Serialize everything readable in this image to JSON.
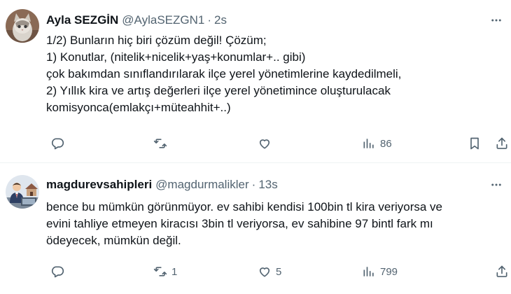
{
  "tweets": [
    {
      "author": {
        "name": "Ayla SEZGİN",
        "handle": "@AylaSEZGN1",
        "time": "2s"
      },
      "lines": [
        "1/2) Bunların hiç biri çözüm değil! Çözüm;",
        "1) Konutlar, (nitelik+nicelik+yaş+konumlar+.. gibi)",
        "çok bakımdan sınıflandırılarak ilçe yerel yönetimlerine kaydedilmeli,",
        "2) Yıllık kira ve artış değerleri ilçe yerel yönetimince oluşturulacak",
        "komisyonca(emlakçı+müteahhit+..)"
      ],
      "stats": {
        "replies": "",
        "retweets": "",
        "likes": "",
        "views": "86"
      }
    },
    {
      "author": {
        "name": "magdurevsahipleri",
        "handle": "@magdurmalikler",
        "time": "13s"
      },
      "lines": [
        "bence bu mümkün görünmüyor. ev sahibi kendisi 100bin tl kira veriyorsa ve",
        "evini tahliye etmeyen kiracısı 3bin tl veriyorsa, ev sahibine 97 bintl fark mı",
        "ödeyecek, mümkün değil."
      ],
      "stats": {
        "replies": "",
        "retweets": "1",
        "likes": "5",
        "views": "799"
      }
    }
  ],
  "icons": {
    "more": "more-dots-icon",
    "reply": "reply-icon",
    "retweet": "retweet-icon",
    "like": "heart-icon",
    "views": "views-bar-chart-icon",
    "bookmark": "bookmark-icon",
    "share": "share-icon"
  },
  "colors": {
    "text": "#0f1419",
    "secondary": "#536471",
    "divider": "#eff3f4"
  }
}
